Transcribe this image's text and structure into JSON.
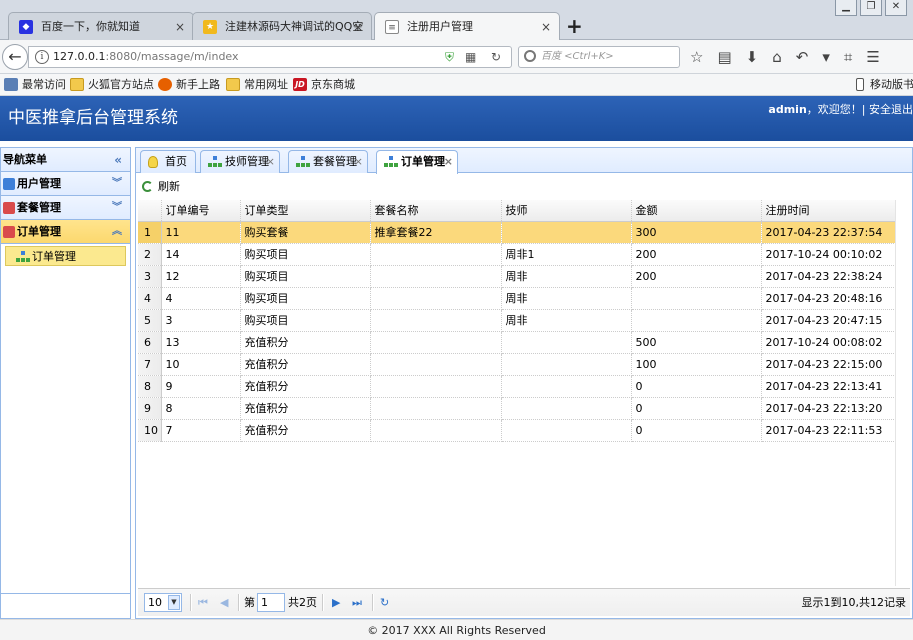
{
  "browser": {
    "tabs": [
      {
        "label": "百度一下，你就知道",
        "icon": "baidu-icon"
      },
      {
        "label": "注建林源码大神调试的QQ空",
        "icon": "qzone-icon"
      },
      {
        "label": "注册用户管理",
        "icon": "page-icon"
      }
    ],
    "url": {
      "host": "127.0.0.1",
      "rest": ":8080/massage/m/index"
    },
    "search_placeholder": "百度 <Ctrl+K>"
  },
  "bookmarks": [
    {
      "label": "最常访问",
      "icon": "grid"
    },
    {
      "label": "火狐官方站点",
      "icon": "folder"
    },
    {
      "label": "新手上路",
      "icon": "fox"
    },
    {
      "label": "常用网址",
      "icon": "folder"
    },
    {
      "label": "京东商城",
      "icon": "jd"
    },
    {
      "label": "移动版书签",
      "icon": "phone"
    }
  ],
  "app": {
    "title": "中医推拿后台管理系统",
    "user": "admin",
    "welcome": "，欢迎您！| 安全退出"
  },
  "nav": {
    "title": "导航菜单",
    "sections": [
      {
        "label": "用户管理"
      },
      {
        "label": "套餐管理"
      },
      {
        "label": "订单管理"
      }
    ],
    "active_item": "订单管理"
  },
  "content_tabs": [
    {
      "label": "首页"
    },
    {
      "label": "技师管理"
    },
    {
      "label": "套餐管理"
    },
    {
      "label": "订单管理"
    }
  ],
  "toolbar": {
    "refresh": "刷新"
  },
  "grid": {
    "columns": [
      "订单编号",
      "订单类型",
      "套餐名称",
      "技师",
      "金额",
      "注册时间"
    ],
    "rows": [
      [
        "1",
        "11",
        "购买套餐",
        "推拿套餐22",
        "",
        "300",
        "2017-04-23 22:37:54"
      ],
      [
        "2",
        "14",
        "购买项目",
        "",
        "周非1",
        "200",
        "2017-10-24 00:10:02"
      ],
      [
        "3",
        "12",
        "购买项目",
        "",
        "周非",
        "200",
        "2017-04-23 22:38:24"
      ],
      [
        "4",
        "4",
        "购买项目",
        "",
        "周非",
        "",
        "2017-04-23 20:48:16"
      ],
      [
        "5",
        "3",
        "购买项目",
        "",
        "周非",
        "",
        "2017-04-23 20:47:15"
      ],
      [
        "6",
        "13",
        "充值积分",
        "",
        "",
        "500",
        "2017-10-24 00:08:02"
      ],
      [
        "7",
        "10",
        "充值积分",
        "",
        "",
        "100",
        "2017-04-23 22:15:00"
      ],
      [
        "8",
        "9",
        "充值积分",
        "",
        "",
        "0",
        "2017-04-23 22:13:41"
      ],
      [
        "9",
        "8",
        "充值积分",
        "",
        "",
        "0",
        "2017-04-23 22:13:20"
      ],
      [
        "10",
        "7",
        "充值积分",
        "",
        "",
        "0",
        "2017-04-23 22:11:53"
      ]
    ],
    "selected_row": 0
  },
  "pager": {
    "page_size": "10",
    "page_prefix": "第",
    "page_value": "1",
    "page_total": "共2页",
    "info": "显示1到10,共12记录"
  },
  "footer": "© 2017 XXX All Rights Reserved",
  "colors": {
    "header_blue": "#1b4e9e",
    "panel_border": "#95b8e7",
    "selected_row": "#fbd97c"
  }
}
